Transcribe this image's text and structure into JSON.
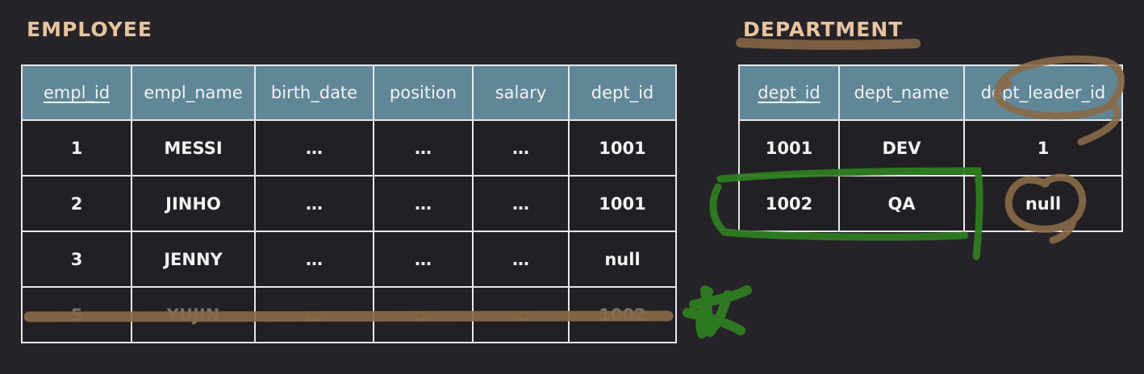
{
  "employee": {
    "title": "EMPLOYEE",
    "columns": [
      "empl_id",
      "empl_name",
      "birth_date",
      "position",
      "salary",
      "dept_id"
    ],
    "rows": [
      [
        "1",
        "MESSI",
        "…",
        "…",
        "…",
        "1001"
      ],
      [
        "2",
        "JINHO",
        "…",
        "…",
        "…",
        "1001"
      ],
      [
        "3",
        "JENNY",
        "…",
        "…",
        "…",
        "null"
      ],
      [
        "5",
        "YUJIN",
        "…",
        "…",
        "…",
        "1002"
      ]
    ]
  },
  "department": {
    "title": "DEPARTMENT",
    "columns": [
      "dept_id",
      "dept_name",
      "dept_leader_id"
    ],
    "rows": [
      [
        "1001",
        "DEV",
        "1"
      ],
      [
        "1002",
        "QA",
        "null"
      ]
    ]
  },
  "colors": {
    "background": "#262428",
    "header": "#5f8797",
    "title": "#e8c4a0",
    "annotation_brown": "#8a6a48",
    "annotation_green": "#2e7d22"
  }
}
